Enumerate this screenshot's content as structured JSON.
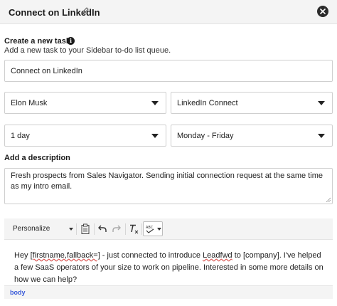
{
  "header": {
    "title": "Connect on LinkedIn",
    "edit_icon": "pencil-icon",
    "close_icon": "close-icon"
  },
  "task_section": {
    "heading": "Create a new task",
    "info_icon": "info-icon",
    "info_glyph": "i",
    "subtitle": "Add a new task to your Sidebar to-do list queue."
  },
  "task_name": {
    "value": "Connect on LinkedIn"
  },
  "assignee": {
    "selected": "Elon Musk"
  },
  "task_type": {
    "selected": "LinkedIn Connect"
  },
  "due": {
    "selected": "1 day"
  },
  "schedule": {
    "selected": "Monday - Friday"
  },
  "description": {
    "heading": "Add a description",
    "value": "Fresh prospects from Sales Navigator. Sending initial connection request at the same time as my intro email."
  },
  "editor_toolbar": {
    "personalize_label": "Personalize",
    "icons": [
      "clipboard-icon",
      "undo-icon",
      "redo-icon",
      "clear-format-icon",
      "spellcheck-icon"
    ]
  },
  "editor": {
    "segments": [
      {
        "text": "Hey ",
        "err": false
      },
      {
        "text": "[firstname,fallback=]",
        "err": true
      },
      {
        "text": " - just connected to introduce ",
        "err": false
      },
      {
        "text": "Leadfwd",
        "err": true
      },
      {
        "text": " to [company]. I've helped a few SaaS operators of your size to work on pipeline. Interested in some more details on how we can help?",
        "err": false
      }
    ]
  },
  "statusbar": {
    "path": "body"
  },
  "colors": {
    "spell_error": "#d9534f",
    "status_path": "#3a5bd9",
    "header_bg": "#f4f4f4"
  }
}
